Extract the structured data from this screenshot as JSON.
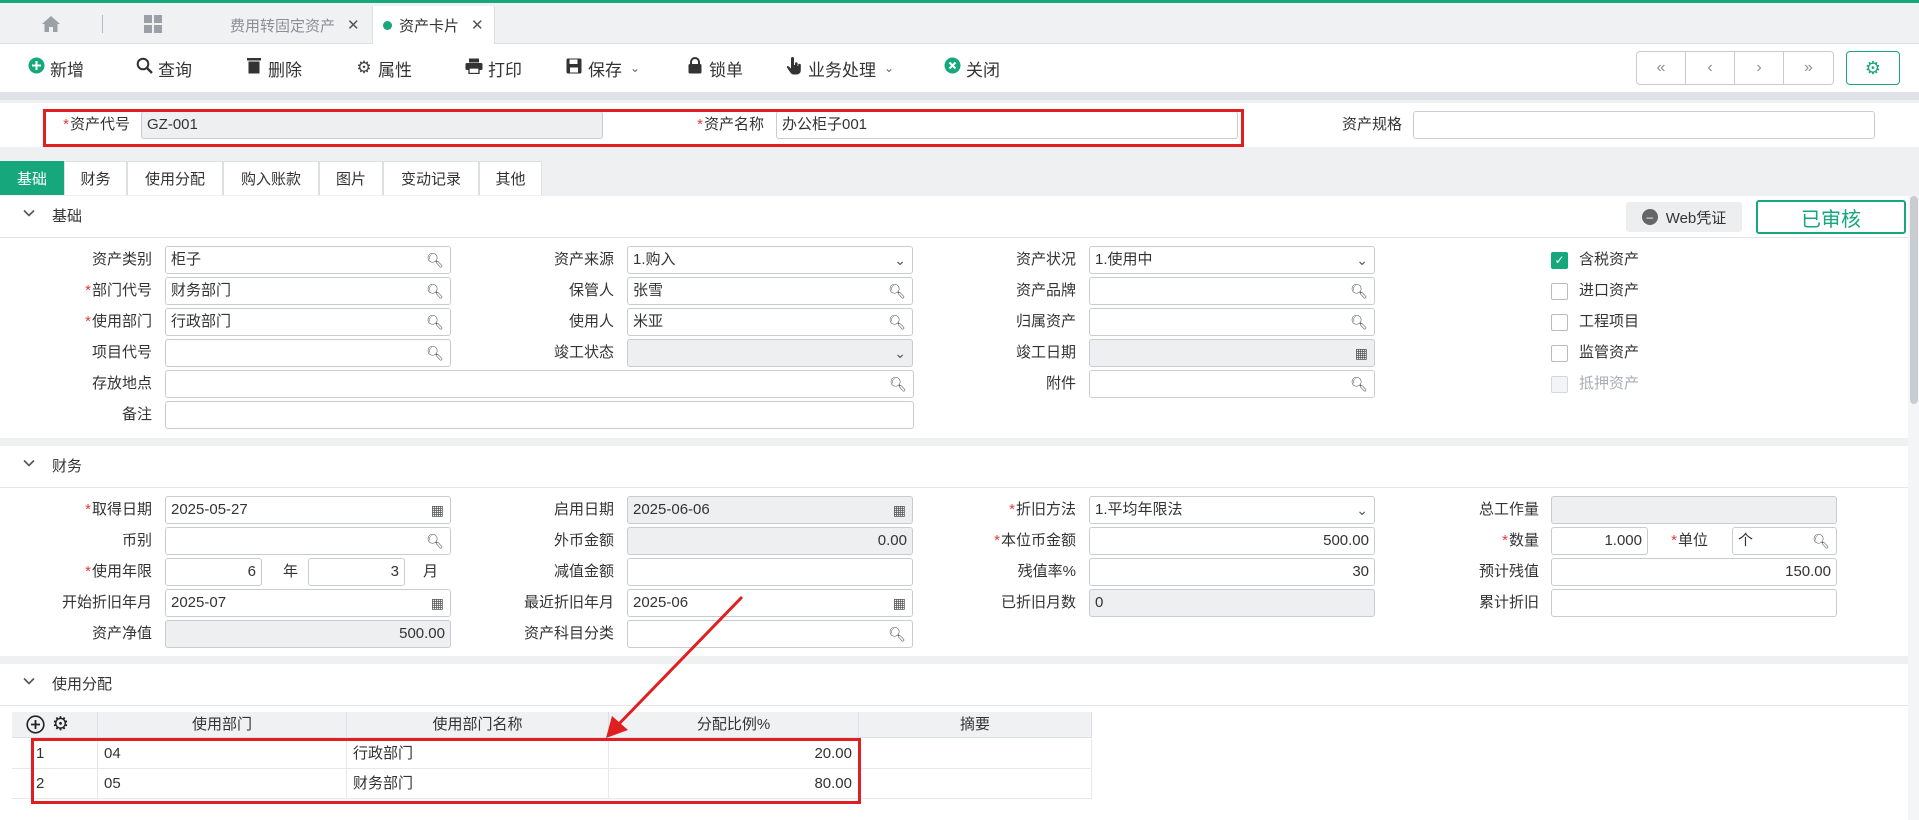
{
  "tabs": {
    "home_icon": "home-icon",
    "grid_icon": "grid-icon",
    "items": [
      {
        "label": "费用转固定资产",
        "close": "✕"
      },
      {
        "label": "资产卡片",
        "close": "✕"
      }
    ]
  },
  "toolbar": {
    "buttons": [
      {
        "label": "新增",
        "icon": "plus-circle-icon"
      },
      {
        "label": "查询",
        "icon": "search-icon"
      },
      {
        "label": "删除",
        "icon": "trash-icon"
      },
      {
        "label": "属性",
        "icon": "gear-icon"
      },
      {
        "label": "打印",
        "icon": "printer-icon"
      },
      {
        "label": "保存",
        "icon": "save-icon"
      },
      {
        "label": "锁单",
        "icon": "lock-icon"
      },
      {
        "label": "业务处理",
        "icon": "hand-pointer-icon"
      },
      {
        "label": "关闭",
        "icon": "close-circle-icon"
      }
    ],
    "nav": [
      "«",
      "‹",
      "›",
      "»"
    ]
  },
  "header": {
    "asset_code_label": "资产代号",
    "asset_code": "GZ-001",
    "asset_name_label": "资产名称",
    "asset_name": "办公柜子001",
    "asset_spec_label": "资产规格",
    "asset_spec": ""
  },
  "subtabs": [
    "基础",
    "财务",
    "使用分配",
    "购入账款",
    "图片",
    "变动记录",
    "其他"
  ],
  "basic": {
    "title": "基础",
    "web_voucher": "Web凭证",
    "audit_status": "已审核",
    "col1": [
      {
        "label": "资产类别",
        "value": "柜子",
        "required": false
      },
      {
        "label": "部门代号",
        "value": "财务部门",
        "required": true
      },
      {
        "label": "使用部门",
        "value": "行政部门",
        "required": true
      },
      {
        "label": "项目代号",
        "value": "",
        "required": false
      },
      {
        "label": "存放地点",
        "value": "",
        "required": false
      },
      {
        "label": "备注",
        "value": "",
        "required": false
      }
    ],
    "col2": [
      {
        "label": "资产来源",
        "value": "1.购入"
      },
      {
        "label": "保管人",
        "value": "张雪"
      },
      {
        "label": "使用人",
        "value": "米亚"
      },
      {
        "label": "竣工状态",
        "value": ""
      }
    ],
    "col3": [
      {
        "label": "资产状况",
        "value": "1.使用中"
      },
      {
        "label": "资产品牌",
        "value": ""
      },
      {
        "label": "归属资产",
        "value": ""
      },
      {
        "label": "竣工日期",
        "value": ""
      },
      {
        "label": "附件",
        "value": ""
      }
    ],
    "checks": [
      {
        "label": "含税资产",
        "checked": true
      },
      {
        "label": "进口资产",
        "checked": false
      },
      {
        "label": "工程项目",
        "checked": false
      },
      {
        "label": "监管资产",
        "checked": false
      },
      {
        "label": "抵押资产",
        "checked": false
      }
    ]
  },
  "finance": {
    "title": "财务",
    "acquire_date_label": "取得日期",
    "acquire_date": "2025-05-27",
    "currency_label": "币别",
    "currency": "",
    "use_years_label": "使用年限",
    "use_years": "6",
    "year_unit": "年",
    "use_months": "3",
    "month_unit": "月",
    "dep_start_label": "开始折旧年月",
    "dep_start": "2025-07",
    "net_value_label": "资产净值",
    "net_value": "500.00",
    "enable_date_label": "启用日期",
    "enable_date": "2025-06-06",
    "foreign_amount_label": "外币金额",
    "foreign_amount": "0.00",
    "impair_label": "减值金额",
    "impair": "",
    "last_dep_label": "最近折旧年月",
    "last_dep": "2025-06",
    "subject_class_label": "资产科目分类",
    "subject_class": "",
    "dep_method_label": "折旧方法",
    "dep_method": "1.平均年限法",
    "local_amount_label": "本位币金额",
    "local_amount": "500.00",
    "residual_rate_label": "残值率%",
    "residual_rate": "30",
    "dep_months_label": "已折旧月数",
    "dep_months": "0",
    "total_work_label": "总工作量",
    "total_work": "",
    "qty_label": "数量",
    "qty": "1.000",
    "unit_label": "单位",
    "unit": "个",
    "est_residual_label": "预计残值",
    "est_residual": "150.00",
    "acc_dep_label": "累计折旧",
    "acc_dep": ""
  },
  "allocation": {
    "title": "使用分配",
    "columns": [
      "使用部门",
      "使用部门名称",
      "分配比例%",
      "摘要"
    ],
    "rows": [
      {
        "no": "1",
        "dept": "04",
        "name": "行政部门",
        "ratio": "20.00",
        "memo": ""
      },
      {
        "no": "2",
        "dept": "05",
        "name": "财务部门",
        "ratio": "80.00",
        "memo": ""
      }
    ]
  },
  "colors": {
    "accent": "#16a87c",
    "annotation": "#e02020"
  }
}
